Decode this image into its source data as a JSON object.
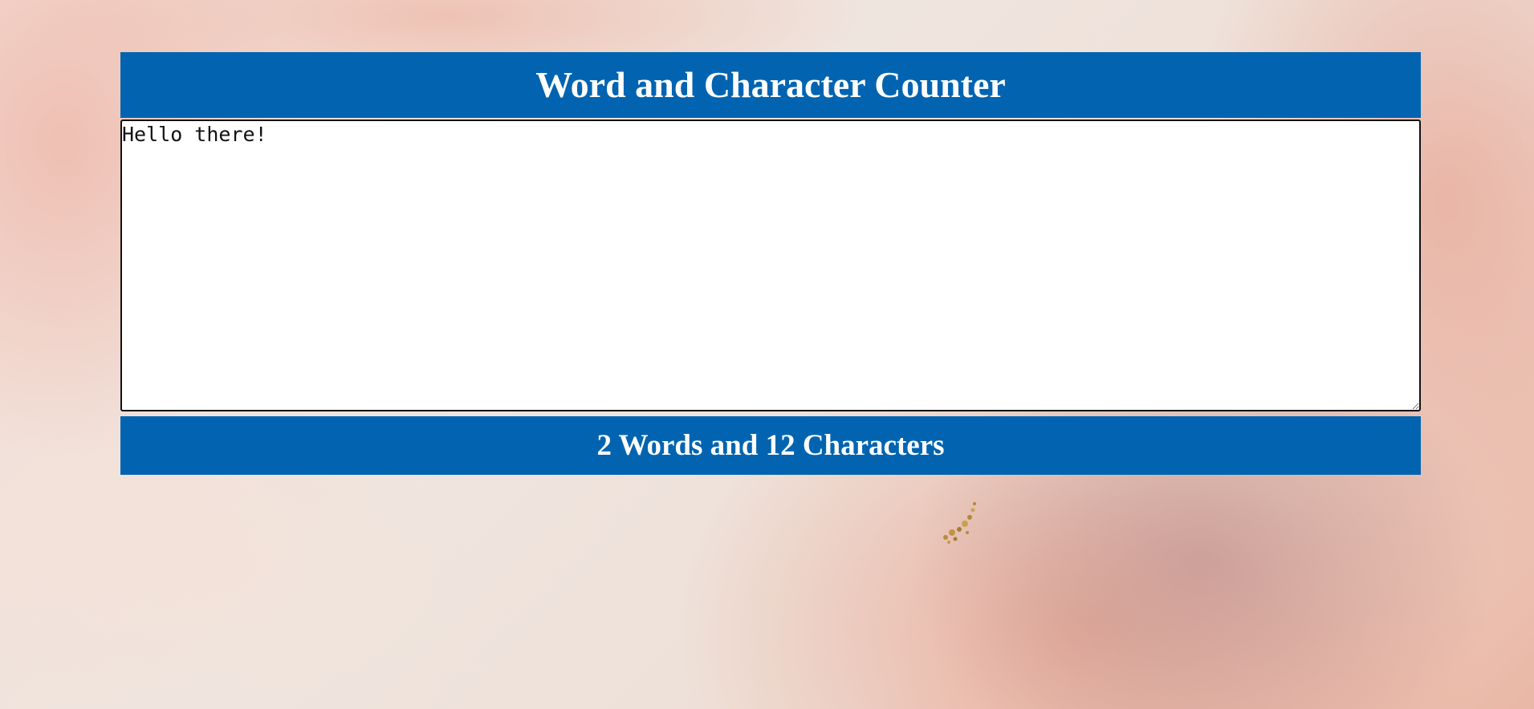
{
  "header": {
    "title": "Word and Character Counter"
  },
  "editor": {
    "value": "Hello there!"
  },
  "stats": {
    "words": "2",
    "words_label": "Words",
    "connector": "and",
    "characters": "12",
    "characters_label": "Characters"
  },
  "colors": {
    "banner": "#0264b0",
    "banner_text": "#ffffff",
    "editor_border": "#111111"
  }
}
